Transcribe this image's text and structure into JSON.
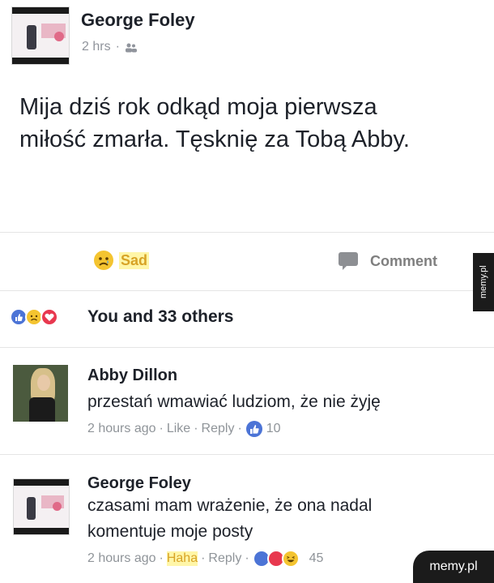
{
  "post": {
    "author": "George Foley",
    "time": "2 hrs",
    "separator": "·",
    "text_line1": "Mija dziś rok odkąd moja pierwsza",
    "text_line2": "miłość zmarła. Tęsknię za Tobą Abby."
  },
  "actions": {
    "sad_label": "Sad",
    "comment_label": "Comment"
  },
  "reactions_summary": "You and 33 others",
  "comments": [
    {
      "author": "Abby Dillon",
      "text_line1": "przestań wmawiać ludziom, że nie żyję",
      "time": "2 hours ago",
      "action1": "Like",
      "action2": "Reply",
      "reaction_count": "10"
    },
    {
      "author": "George Foley",
      "text_line1": "czasami mam wrażenie, że ona nadal",
      "text_line2": "komentuje moje posty",
      "time": "2 hours ago",
      "action1": "Haha",
      "action2": "Reply",
      "reaction_count": "45"
    }
  ],
  "watermarks": {
    "side": "memy.pl",
    "corner": "memy.pl"
  },
  "colors": {
    "fb_blue": "#4c74d6",
    "sad_yellow": "#f4c430",
    "love_red": "#e8384f",
    "highlight": "#fff6a8"
  }
}
